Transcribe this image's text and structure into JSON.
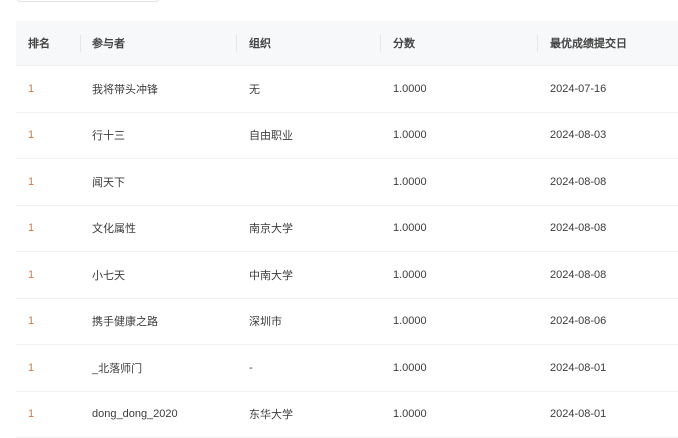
{
  "table": {
    "headers": [
      "排名",
      "参与者",
      "组织",
      "分数",
      "最优成绩提交日"
    ],
    "rows": [
      {
        "rank": "1",
        "participant": "我将带头冲锋",
        "org": "无",
        "score": "1.0000",
        "date": "2024-07-16"
      },
      {
        "rank": "1",
        "participant": "行十三",
        "org": "自由职业",
        "score": "1.0000",
        "date": "2024-08-03"
      },
      {
        "rank": "1",
        "participant": "闻天下",
        "org": "",
        "score": "1.0000",
        "date": "2024-08-08"
      },
      {
        "rank": "1",
        "participant": "文化属性",
        "org": "南京大学",
        "score": "1.0000",
        "date": "2024-08-08"
      },
      {
        "rank": "1",
        "participant": "小七天",
        "org": "中南大学",
        "score": "1.0000",
        "date": "2024-08-08"
      },
      {
        "rank": "1",
        "participant": "携手健康之路",
        "org": "深圳市",
        "score": "1.0000",
        "date": "2024-08-06"
      },
      {
        "rank": "1",
        "participant": "_北落师门",
        "org": "-",
        "score": "1.0000",
        "date": "2024-08-01"
      },
      {
        "rank": "1",
        "participant": "dong_dong_2020",
        "org": "东华大学",
        "score": "1.0000",
        "date": "2024-08-01"
      }
    ]
  },
  "colors": {
    "rank": "#e8742a",
    "header_bg": "#f7f8fa"
  }
}
